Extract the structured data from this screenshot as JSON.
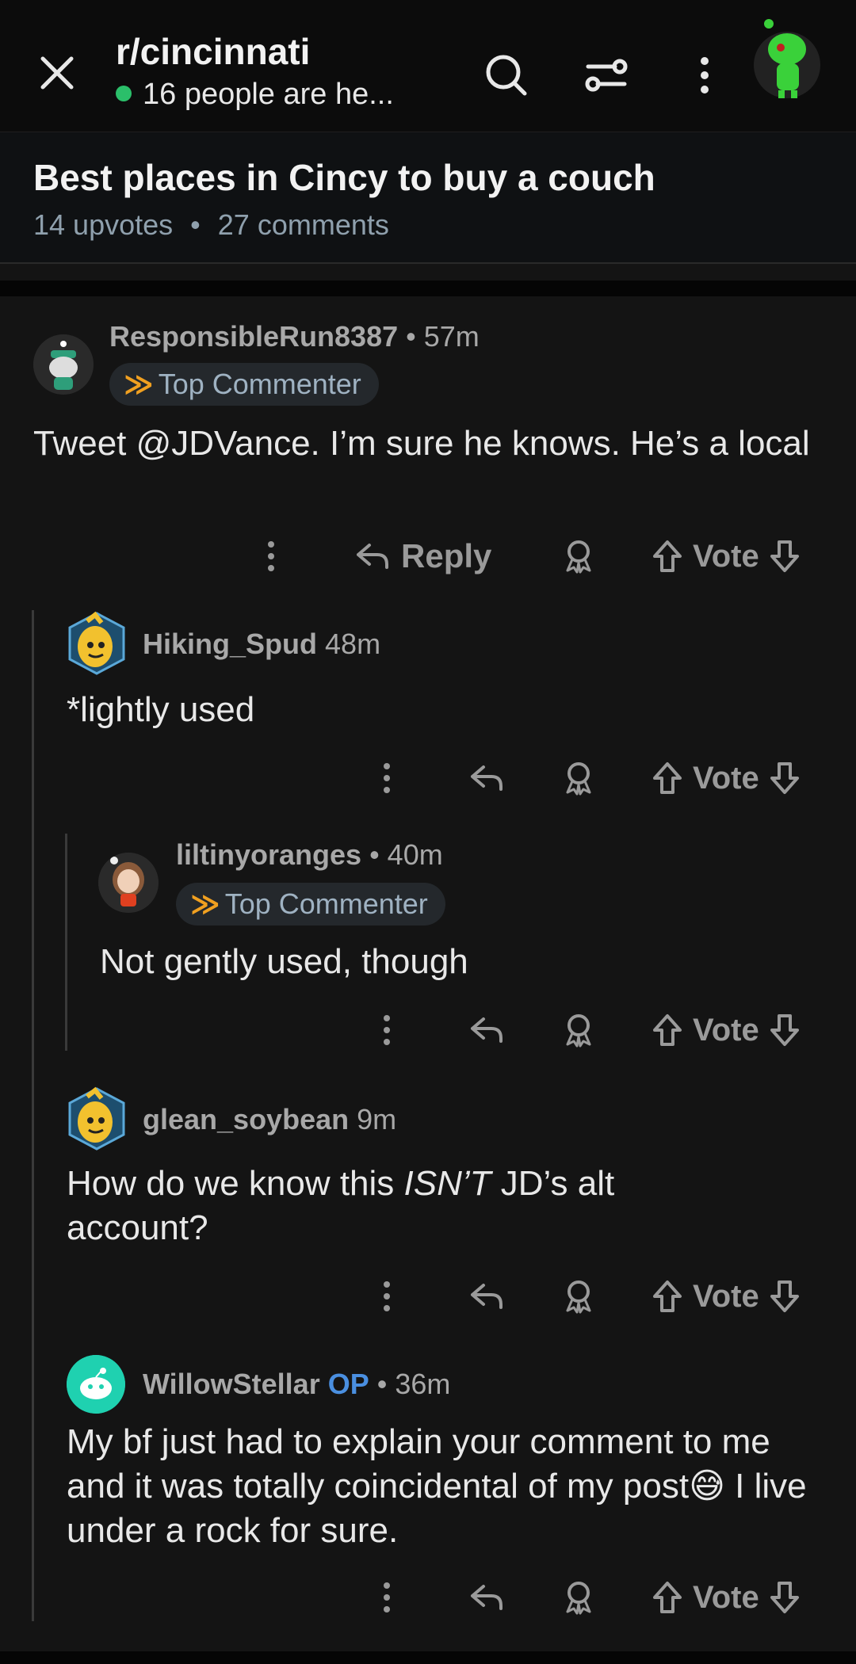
{
  "header": {
    "subreddit": "r/cincinnati",
    "online_text": "16 people are he..."
  },
  "post": {
    "title": "Best places in Cincy to buy a couch",
    "upvotes": "14 upvotes",
    "comments": "27 comments"
  },
  "comments": [
    {
      "username": "ResponsibleRun8387",
      "time": "57m",
      "badge": "Top Commenter",
      "text": "Tweet @JDVance. I’m sure he knows. He’s a local",
      "reply_label": "Reply",
      "vote_label": "Vote"
    },
    {
      "username": "Hiking_Spud",
      "time": "48m",
      "text": "*lightly used",
      "vote_label": "Vote"
    },
    {
      "username": "liltinyoranges",
      "time": "40m",
      "badge": "Top Commenter",
      "text": "Not gently used, though",
      "vote_label": "Vote"
    },
    {
      "username": "glean_soybean",
      "time": "9m",
      "text_before": "How do we know this ",
      "text_emph": "ISN’T",
      "text_after": " JD’s alt account?",
      "vote_label": "Vote"
    },
    {
      "username": "WillowStellar",
      "op_label": "OP",
      "time": "36m",
      "text_before": "My bf just had to explain your comment to me and it was totally coincidental of my post",
      "emoji": "😅",
      "text_after": " I live under a rock for sure.",
      "vote_label": "Vote"
    }
  ],
  "icons": {
    "close": "close-icon",
    "search": "search-icon",
    "filter": "filter-icon",
    "more": "more-vertical-icon",
    "reply": "reply-arrow-icon",
    "award": "award-icon",
    "upvote": "upvote-arrow-icon",
    "downvote": "downvote-arrow-icon"
  },
  "colors": {
    "online_dot": "#2bbf6a",
    "op": "#4a8fe0",
    "badge_bg": "#24282c",
    "badge_text": "#9fb2c2"
  }
}
